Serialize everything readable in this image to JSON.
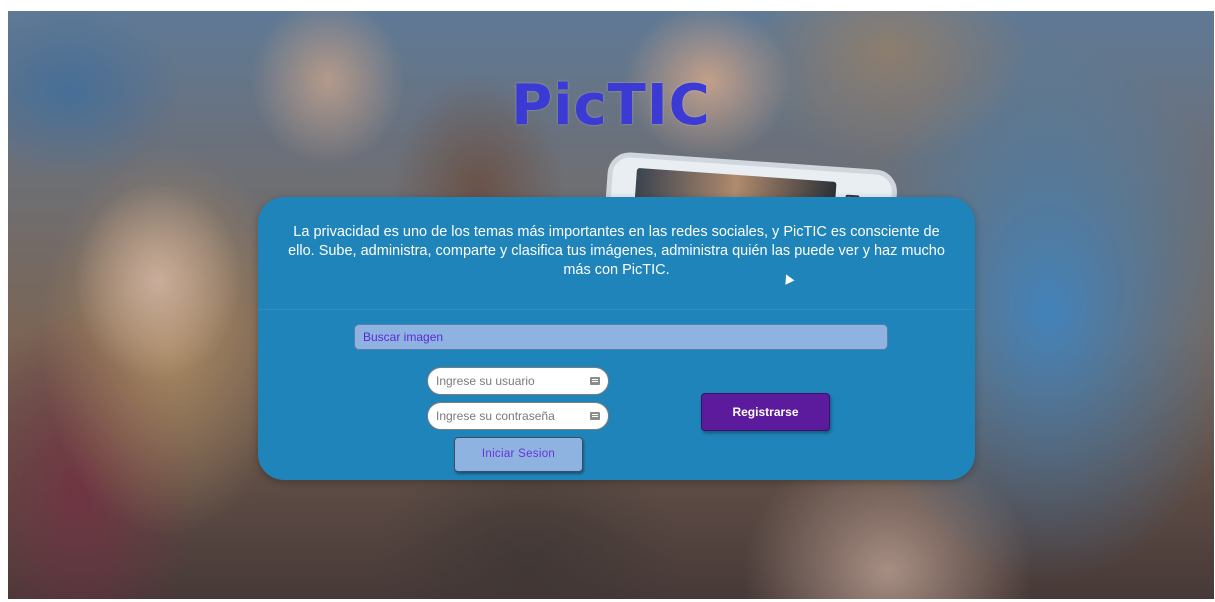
{
  "app": {
    "logo_text": "PicTIC"
  },
  "panel": {
    "intro_text": "La privacidad es uno de los temas más importantes en las redes sociales, y PicTIC es consciente de ello. Sube, administra, comparte y clasifica tus imágenes, administra quién las puede ver y haz mucho más con PicTIC."
  },
  "search": {
    "placeholder": "Buscar imagen",
    "value": ""
  },
  "login": {
    "username_placeholder": "Ingrese su usuario",
    "username_value": "",
    "password_placeholder": "Ingrese su contraseña",
    "password_value": "",
    "login_label": "Iniciar Sesion"
  },
  "register": {
    "label": "Registrarse"
  },
  "colors": {
    "logo": "#3b3ad4",
    "panel": "#1f84b9",
    "search_bg": "#8fb3e1",
    "accent_purple": "#5b1b9c"
  }
}
